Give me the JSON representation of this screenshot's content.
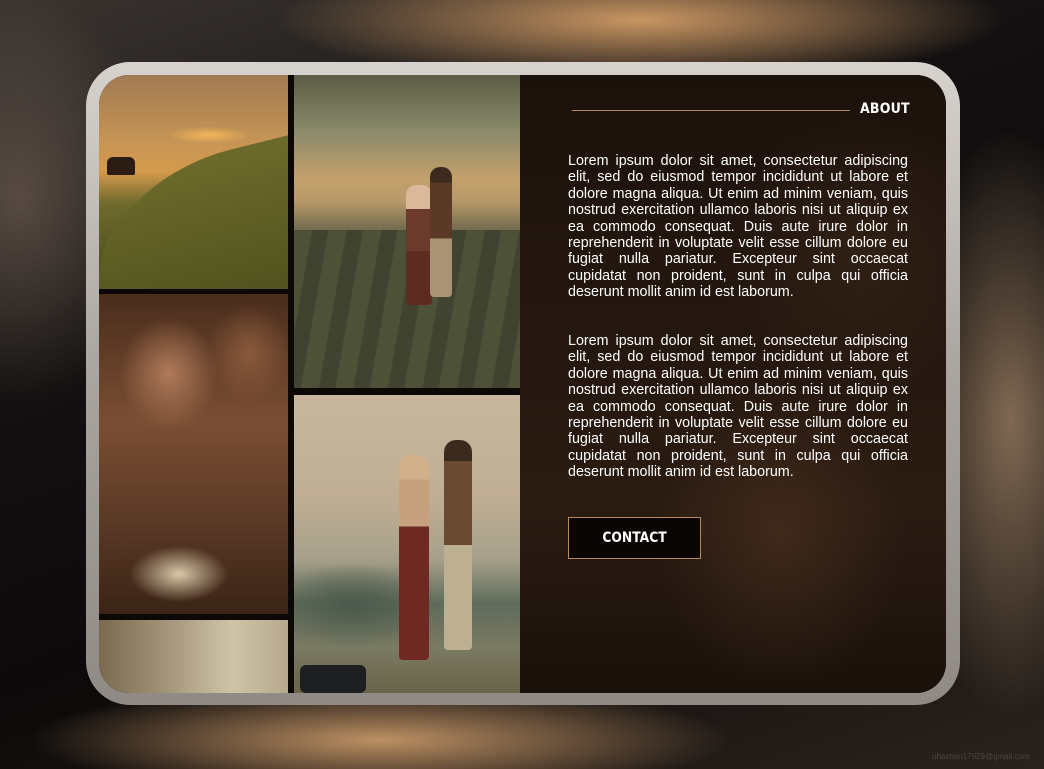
{
  "about": {
    "title": "ABOUT",
    "paragraphs": [
      "Lorem ipsum dolor sit amet, consectetur adipiscing elit, sed do eiusmod tempor incididunt ut labore et dolore magna aliqua. Ut enim ad minim veniam, quis nostrud exercitation ullamco laboris nisi ut aliquip ex ea commodo consequat. Duis aute irure dolor in reprehenderit in voluptate velit esse cillum dolore eu fugiat nulla pariatur. Excepteur sint occaecat cupidatat non proident, sunt in culpa qui officia deserunt mollit anim id est laborum.",
      "Lorem ipsum dolor sit amet, consectetur adipiscing elit, sed do eiusmod tempor incididunt ut labore et dolore magna aliqua. Ut enim ad minim veniam, quis nostrud exercitation ullamco laboris nisi ut aliquip ex ea commodo consequat. Duis aute irure dolor in reprehenderit in voluptate velit esse cillum dolore eu fugiat nulla pariatur. Excepteur sint occaecat cupidatat non proident, sunt in culpa qui officia deserunt mollit anim id est laborum."
    ],
    "contact_label": "CONTACT"
  },
  "watermark": "uhashan17929@gmail.com",
  "colors": {
    "accent": "#b88a5c",
    "panel": "#24170f",
    "frame": "#c9c4bf"
  }
}
